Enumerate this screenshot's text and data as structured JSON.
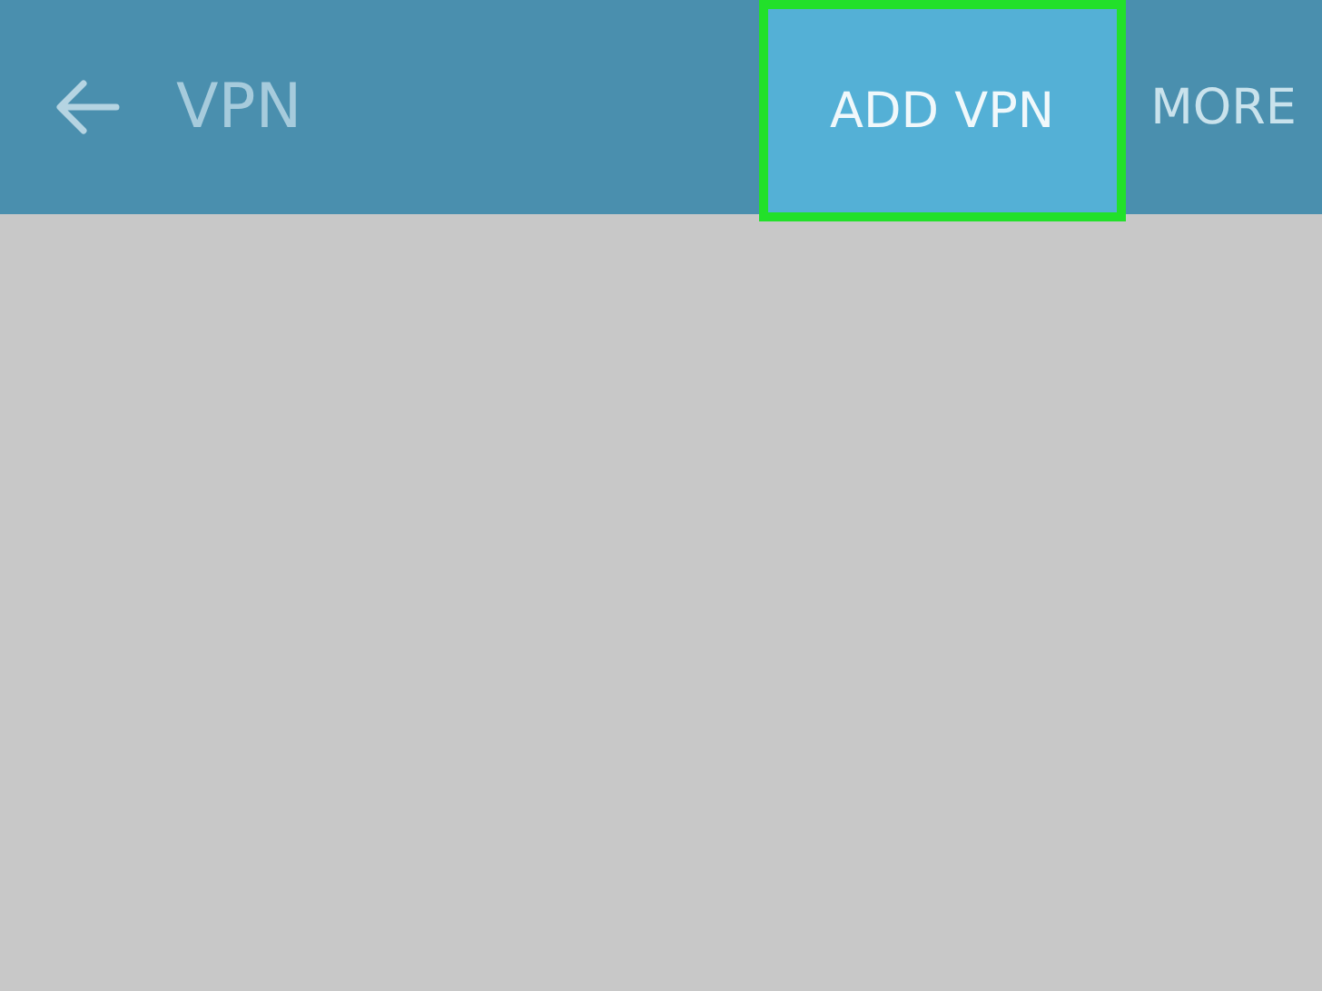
{
  "app_bar": {
    "title": "VPN",
    "actions": [
      {
        "label": "ADD VPN",
        "highlighted": true
      },
      {
        "label": "MORE",
        "highlighted": false
      }
    ]
  }
}
